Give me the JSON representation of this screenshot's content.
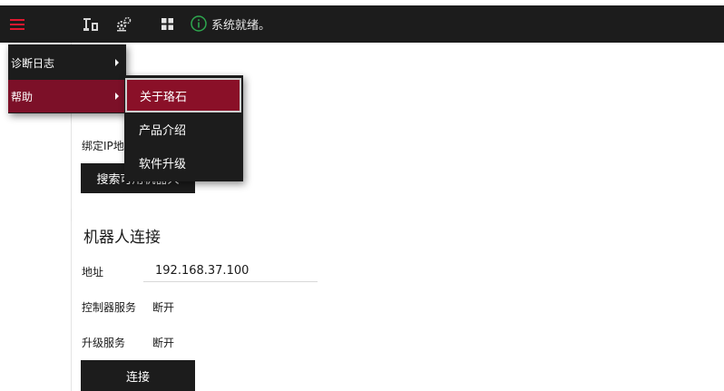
{
  "toolbar": {
    "menu_icon": "hamburger-menu-icon",
    "menu_icon_color": "#e0182f",
    "tool_icons": [
      "robot-arm-icon",
      "gears-icon",
      "grid-icon"
    ],
    "status_icon": "info-icon",
    "status_color": "#2ea84f",
    "status_text": "系统就绪。"
  },
  "main_menu": {
    "items": [
      {
        "label": "诊断日志",
        "has_submenu": true
      },
      {
        "label": "帮助",
        "has_submenu": true,
        "active": true
      }
    ]
  },
  "help_submenu": {
    "items": [
      {
        "label": "关于珞石",
        "active": true
      },
      {
        "label": "产品介绍"
      },
      {
        "label": "软件升级"
      }
    ]
  },
  "search_section": {
    "bind_ip_label": "绑定IP地址",
    "search_button": "搜索可用机器人"
  },
  "robot_connection": {
    "title": "机器人连接",
    "address_label": "地址",
    "address_value": "192.168.37.100",
    "controller_service_label": "控制器服务",
    "controller_service_value": "断开",
    "upgrade_service_label": "升级服务",
    "upgrade_service_value": "断开",
    "connect_button": "连接"
  },
  "colors": {
    "accent": "#7c1028",
    "toolbar_bg": "#1c1c1c"
  }
}
